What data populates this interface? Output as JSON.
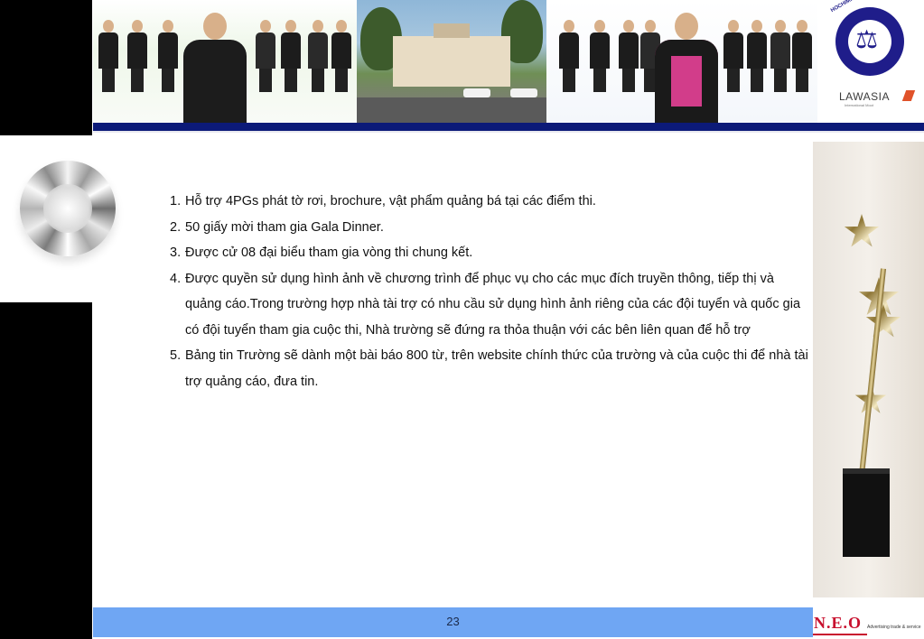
{
  "header": {
    "logo": {
      "university_arc_text": "HOCHIMINH CITY UNIVERSITY OF LAW",
      "brand_text": "LAWASIA",
      "brand_subtext": "International Moot"
    }
  },
  "content": {
    "items": [
      {
        "number": "1.",
        "text": "Hỗ trợ 4PGs phát tờ rơi, brochure, vật phẩm quảng bá tại các điểm thi."
      },
      {
        "number": "2.",
        "text": "50 giấy mời tham gia Gala Dinner."
      },
      {
        "number": "3.",
        "text": "Được cử 08 đại biểu tham gia vòng thi chung kết."
      },
      {
        "number": "4.",
        "text": "Được quyền sử dụng hình ảnh về chương trình để phục vụ cho các mục đích truyền thông, tiếp thị và quảng cáo.Trong trường hợp nhà tài trợ có nhu cầu sử dụng hình ảnh riêng của các đội tuyển và quốc gia có đội tuyển tham gia cuộc thi, Nhà trường sẽ đứng ra thỏa thuận với các bên liên quan để hỗ trợ"
      },
      {
        "number": "5.",
        "text": "Bảng tin Trường sẽ dành một bài báo 800 từ, trên website chính thức của trường và của cuộc thi để nhà tài trợ quảng cáo, đưa tin."
      }
    ]
  },
  "footer": {
    "page_number": "23",
    "company_logo_text": "N.E.O",
    "company_tagline": "Advertising trade & service"
  },
  "colors": {
    "footer_bar": "#6fa6f3",
    "header_strip": "#0c1a78",
    "left_band": "#000000",
    "neo_red": "#c8102e"
  },
  "icons": [
    "diamond-image",
    "trophy-image",
    "university-scale-logo",
    "neo-logo"
  ]
}
